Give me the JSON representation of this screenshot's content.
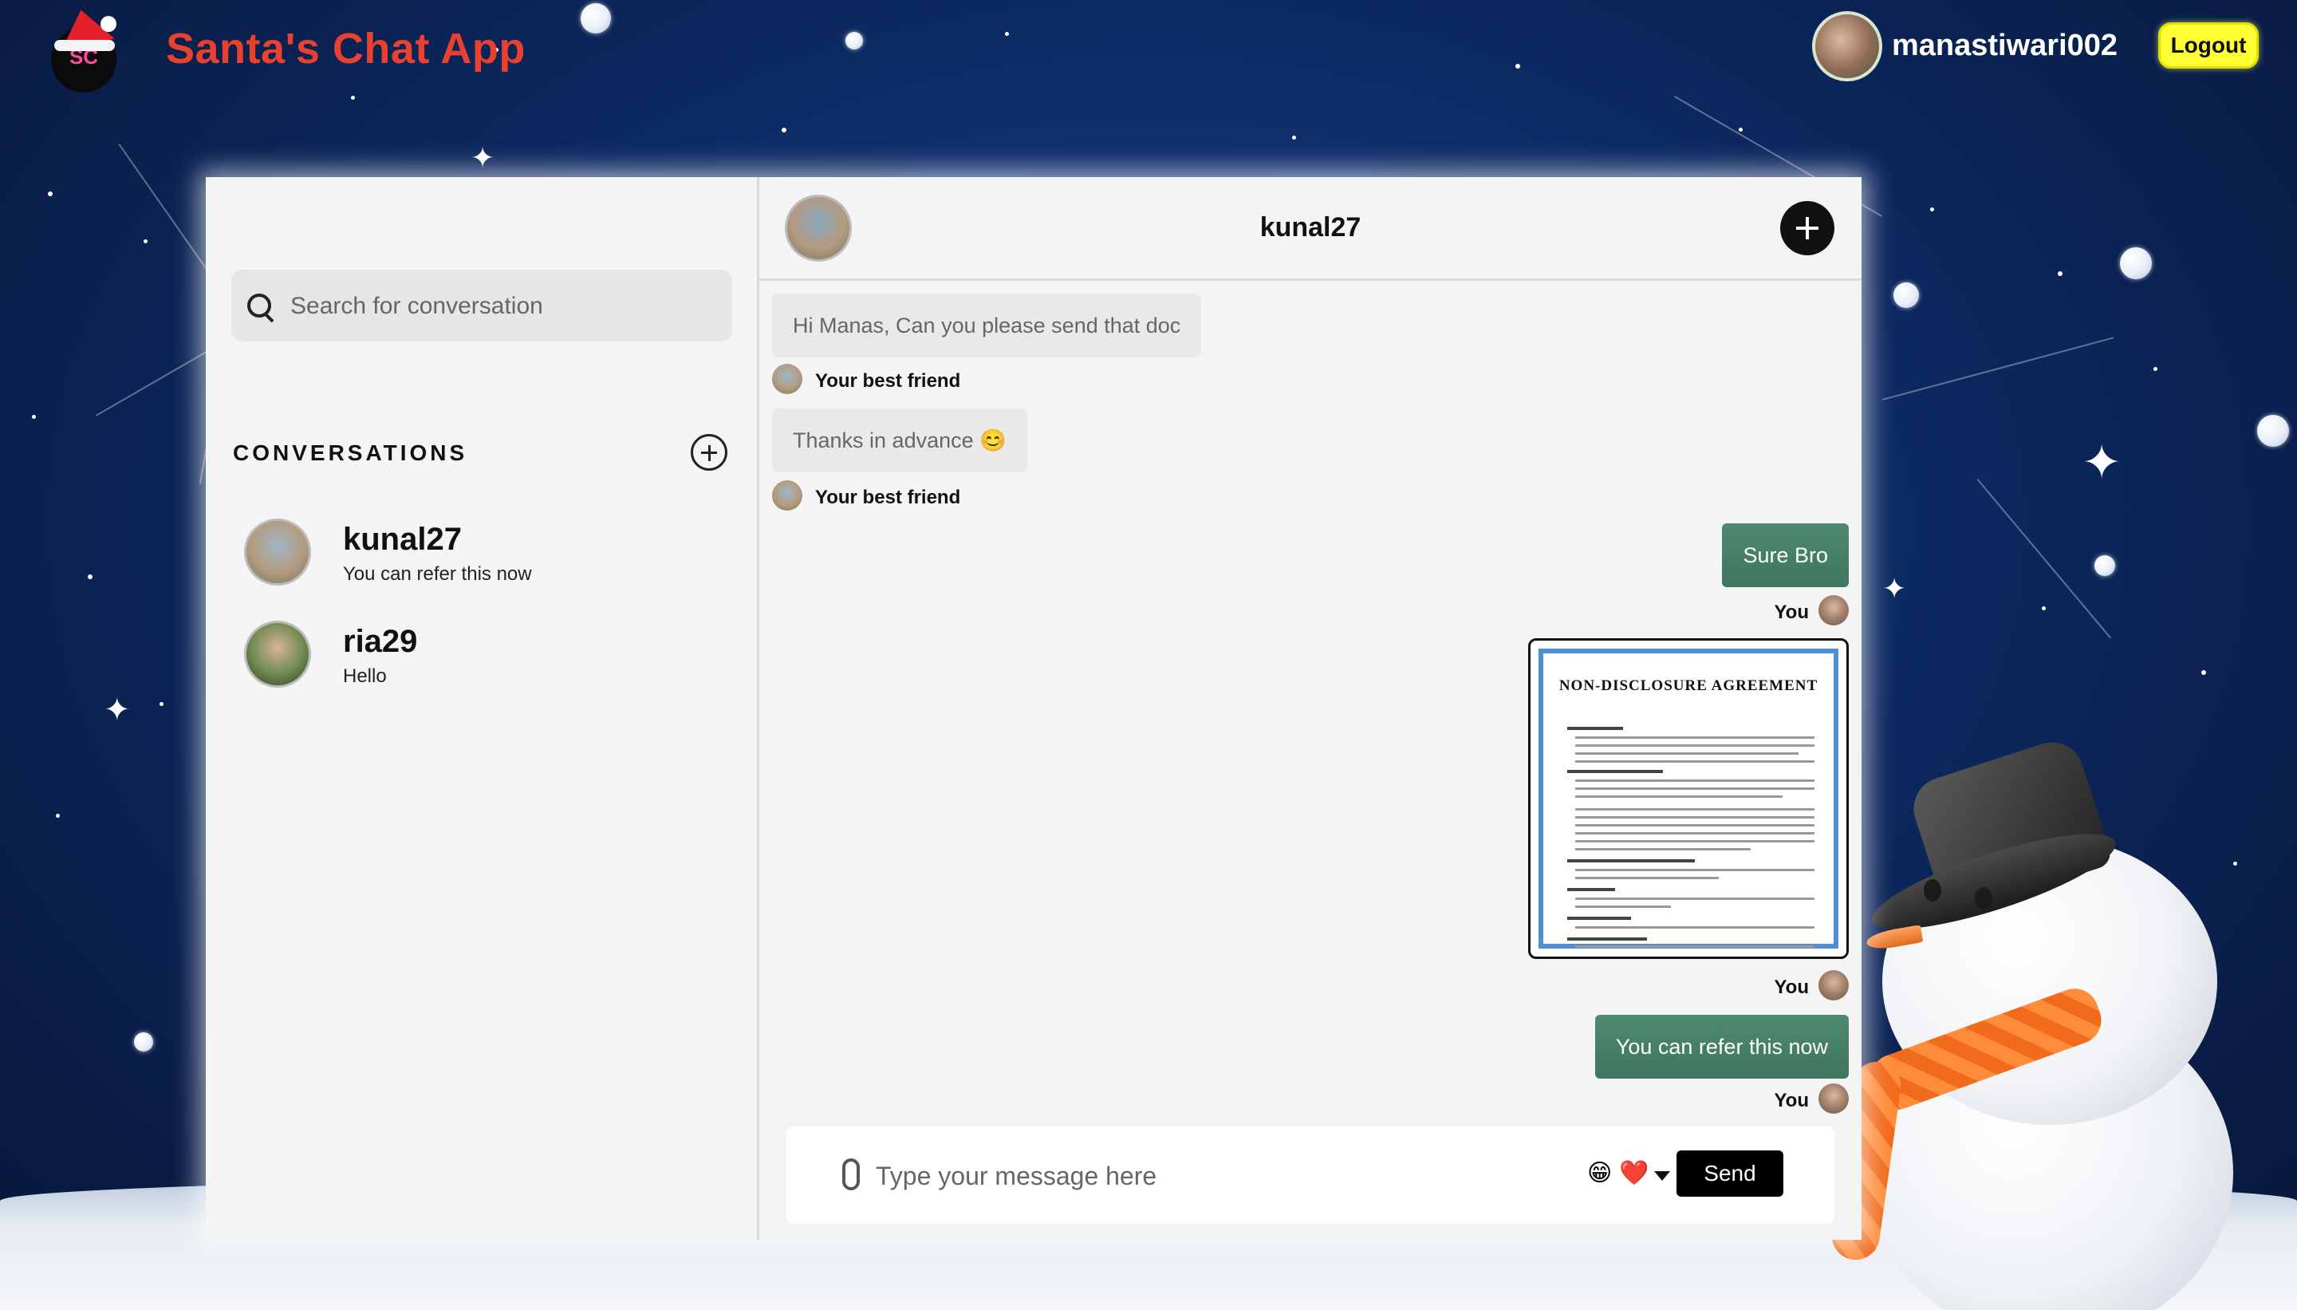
{
  "header": {
    "logo_text": "SC",
    "app_title": "Santa's Chat App",
    "username": "manastiwari002",
    "logout_label": "Logout"
  },
  "sidebar": {
    "search_placeholder": "Search for conversation",
    "section_title": "CONVERSATIONS",
    "conversations": [
      {
        "name": "kunal27",
        "last_message": "You can refer this now"
      },
      {
        "name": "ria29",
        "last_message": "Hello"
      }
    ]
  },
  "chat": {
    "contact_name": "kunal27",
    "messages": [
      {
        "direction": "in",
        "text": "Hi Manas, Can you please send that doc",
        "sender": "Your best friend"
      },
      {
        "direction": "in",
        "text": "Thanks in advance 😊",
        "sender": "Your best friend"
      },
      {
        "direction": "out",
        "text": "Sure Bro",
        "sender": "You"
      },
      {
        "direction": "out",
        "type": "document",
        "doc_title": "NON-DISCLOSURE AGREEMENT",
        "sender": "You"
      },
      {
        "direction": "out",
        "text": "You can refer this now",
        "sender": "You"
      }
    ],
    "composer": {
      "placeholder": "Type your message here",
      "emoji_1": "😁",
      "emoji_2": "❤️",
      "send_label": "Send"
    }
  },
  "colors": {
    "title": "#e8412f",
    "logout_bg": "#ffff33",
    "outgoing_bubble": "#4a8368",
    "incoming_bubble": "#e9e9e9",
    "send_bg": "#000000"
  }
}
